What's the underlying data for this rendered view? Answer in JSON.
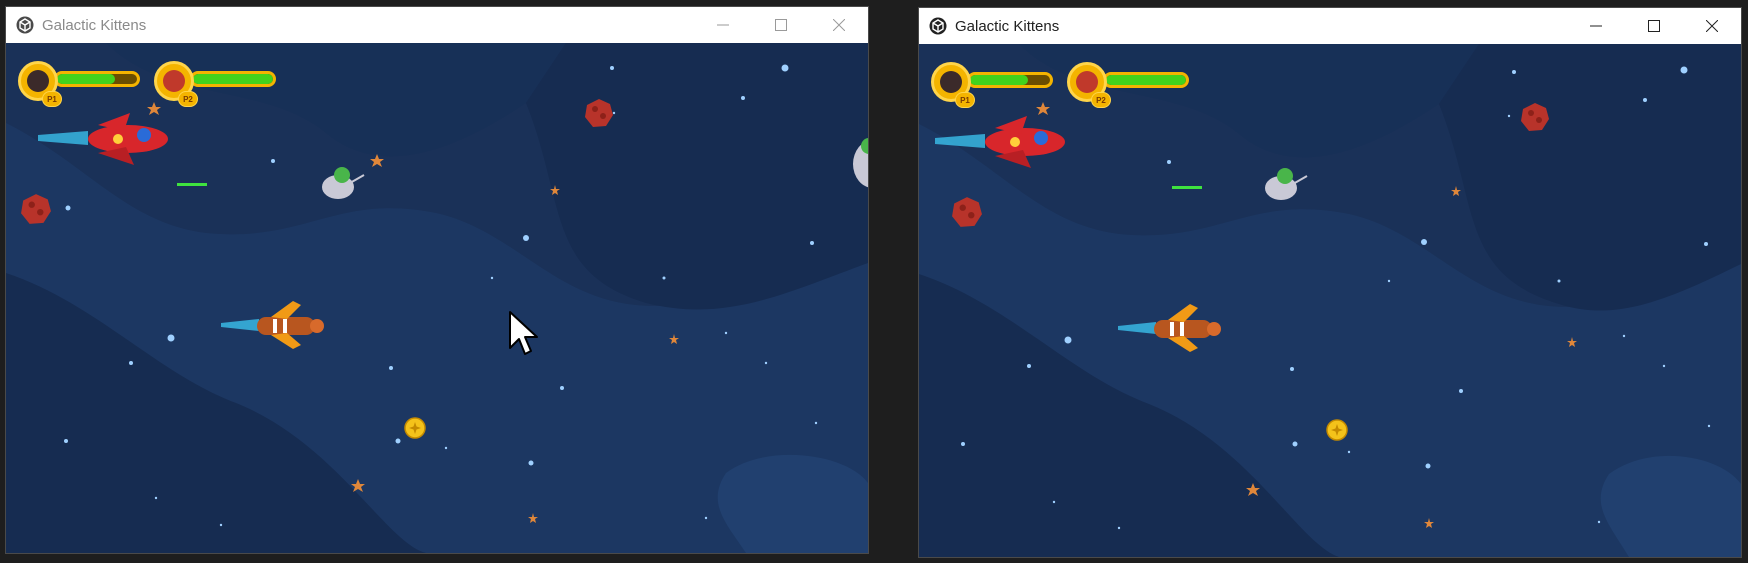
{
  "windows": [
    {
      "title": "Galactic Kittens",
      "app_icon": "unity-logo-icon",
      "title_color": "#8a8a8a",
      "focused": false,
      "hud": {
        "p1": {
          "badge": "P1",
          "health": 0.72
        },
        "p2": {
          "badge": "P2",
          "health": 1.0
        }
      }
    },
    {
      "title": "Galactic Kittens",
      "app_icon": "unity-logo-icon",
      "title_color": "#222222",
      "focused": true,
      "hud": {
        "p1": {
          "badge": "P1",
          "health": 0.72
        },
        "p2": {
          "badge": "P2",
          "health": 1.0
        }
      }
    }
  ],
  "controls": [
    "minimize-icon",
    "maximize-icon",
    "close-icon"
  ],
  "colors": {
    "space_background": "#1a3158",
    "health_fill": "#43d21c",
    "hud_gold": "#f4b400",
    "asteroid": "#b8332a",
    "coin": "#f4c21a"
  }
}
